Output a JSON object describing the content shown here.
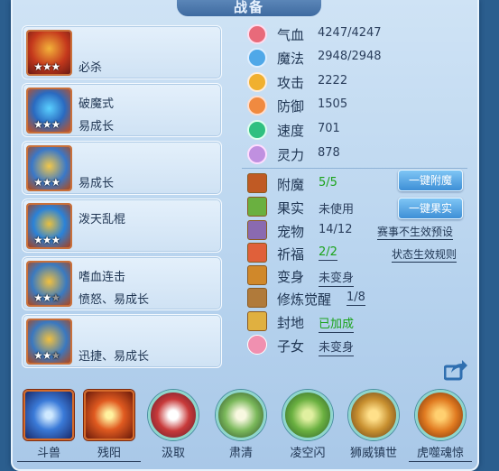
{
  "title": "战备",
  "equipment": [
    {
      "line1": "",
      "line2": "",
      "single": "必杀",
      "stars": "★★★",
      "dim_stars": ""
    },
    {
      "line1": "破魔式",
      "line2": "易成长",
      "single": "",
      "stars": "★★★",
      "dim_stars": ""
    },
    {
      "line1": "",
      "line2": "",
      "single": "易成长",
      "stars": "★★★",
      "dim_stars": ""
    },
    {
      "line1": "",
      "line2": "",
      "single": "泼天乱棍",
      "stars": "★★★",
      "dim_stars": ""
    },
    {
      "line1": "嗜血连击",
      "line2": "愤怒、易成长",
      "single": "",
      "stars": "★★",
      "dim_stars": "★"
    },
    {
      "line1": "",
      "line2": "",
      "single": "迅捷、易成长",
      "stars": "★★",
      "dim_stars": "★"
    }
  ],
  "stats": [
    {
      "label": "气血",
      "value": "4247/4247",
      "icon": "heart-icon",
      "color": "#e86a7a"
    },
    {
      "label": "魔法",
      "value": "2948/2948",
      "icon": "mana-icon",
      "color": "#4fa8e8"
    },
    {
      "label": "攻击",
      "value": "2222",
      "icon": "attack-icon",
      "color": "#f0b030"
    },
    {
      "label": "防御",
      "value": "1505",
      "icon": "defense-icon",
      "color": "#f08a40"
    },
    {
      "label": "速度",
      "value": "701",
      "icon": "speed-icon",
      "color": "#30c080"
    },
    {
      "label": "灵力",
      "value": "878",
      "icon": "spirit-icon",
      "color": "#c090e0"
    }
  ],
  "rows": {
    "fumo": {
      "label": "附魔",
      "value": "5/5",
      "button": "一键附魔"
    },
    "guoshi": {
      "label": "果实",
      "value": "未使用",
      "button": "一键果实"
    },
    "chongwu": {
      "label": "宠物",
      "value": "14/12",
      "link": "赛事不生效预设"
    },
    "qifu": {
      "label": "祈福",
      "value": "2/2",
      "link": "状态生效规则"
    },
    "bianshen": {
      "label": "变身",
      "value": "未变身"
    },
    "xiulian": {
      "label": "修炼觉醒",
      "value": "1/8"
    },
    "fengdi": {
      "label": "封地",
      "value": "已加成"
    },
    "zinv": {
      "label": "子女",
      "value": "未变身"
    }
  },
  "skills": [
    {
      "label": "斗兽",
      "underline": true,
      "shape": "square",
      "color": "#3a7ad8"
    },
    {
      "label": "残阳",
      "underline": true,
      "shape": "square",
      "color": "#e05a20"
    },
    {
      "label": "汲取",
      "underline": false,
      "shape": "round",
      "color": "#c83a3a"
    },
    {
      "label": "肃清",
      "underline": false,
      "shape": "round",
      "color": "#7ab85a"
    },
    {
      "label": "凌空闪",
      "underline": false,
      "shape": "round",
      "color": "#6ab040"
    },
    {
      "label": "狮威镇世",
      "underline": false,
      "shape": "round",
      "color": "#c89030"
    },
    {
      "label": "虎噬魂惊",
      "underline": true,
      "shape": "round",
      "color": "#e07a20"
    }
  ]
}
